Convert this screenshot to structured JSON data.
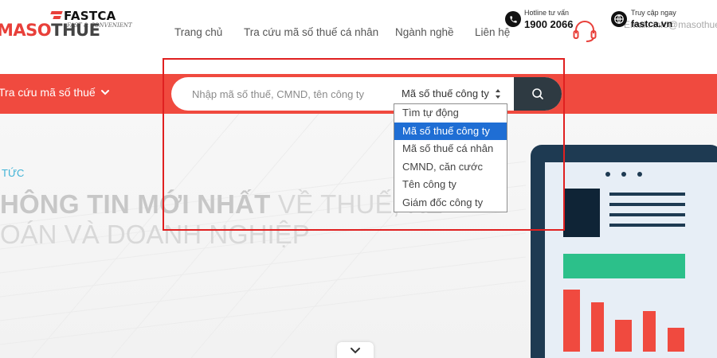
{
  "brand": {
    "maso": "MASO",
    "thue": "THUE",
    "fastca": "FASTCA",
    "fastca_tagline": "FAST & CONVENIENT"
  },
  "nav": {
    "items": [
      "Trang chủ",
      "Tra cứu mã số thuế cá nhân",
      "Ngành nghề",
      "Liên hệ"
    ]
  },
  "hotline": {
    "label": "Hotline tư vấn",
    "value": "1900 2066",
    "icon": "phone-icon"
  },
  "access": {
    "label": "Truy cập ngay",
    "value": "fastca.vn",
    "icon": "globe-icon",
    "ghost_text": "Email: info@masothue.com"
  },
  "searchbar": {
    "lookup_label": "Tra cứu mã số thuế",
    "placeholder": "Nhập mã số thuế, CMND, tên công ty",
    "selected_option": "Mã số thuế công ty",
    "search_icon": "search-icon"
  },
  "dropdown": {
    "options": [
      "Tìm tự động",
      "Mã số thuế công ty",
      "Mã số thuế cá nhân",
      "CMND, căn cước",
      "Tên công ty",
      "Giám đốc công ty"
    ],
    "selected_index": 1
  },
  "hero": {
    "kicker": "TỨC",
    "title_line1_bold": "HÔNG TIN MỚI NHẤT",
    "title_line1_rest": " VỀ THUẾ, KẾ",
    "title_line2": "OÁN VÀ DOANH NGHIỆP"
  },
  "colors": {
    "accent_red": "#f04a3f",
    "search_button": "#2e3a42",
    "selected_option_bg": "#1f6ed4",
    "highlight_frame": "#e02020",
    "kicker": "#3fb3d6"
  }
}
